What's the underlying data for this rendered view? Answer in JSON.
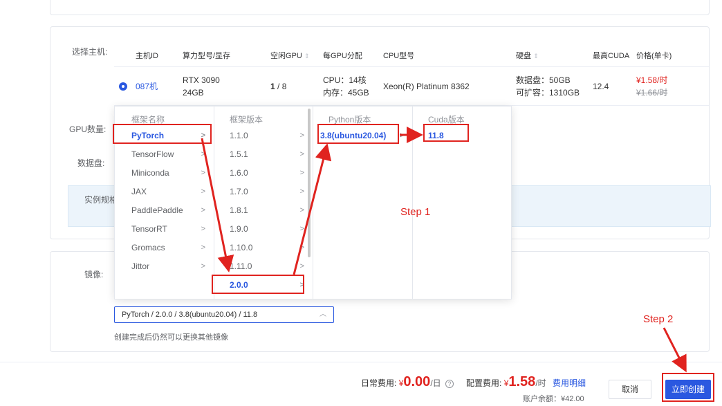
{
  "host": {
    "label": "选择主机:",
    "headers": {
      "host_id": "主机ID",
      "gpu_model": "算力型号/显存",
      "idle_gpu": "空闲GPU",
      "per_gpu": "每GPU分配",
      "cpu_model": "CPU型号",
      "disk": "硬盘",
      "max_cuda": "最高CUDA",
      "price": "价格(单卡)"
    },
    "row": {
      "id": "087机",
      "gpu_name": "RTX 3090",
      "gpu_mem": "24GB",
      "idle_num": "1",
      "idle_total": " / 8",
      "cpu_alloc": "CPU：14核",
      "mem_alloc": "内存：45GB",
      "cpu_model": "Xeon(R) Platinum 8362",
      "data_disk": "数据盘：50GB",
      "expandable": "可扩容：1310GB",
      "cuda": "12.4",
      "price": "¥1.58/时",
      "old_price": "¥1.66/时"
    }
  },
  "form": {
    "gpu_count_label": "GPU数量:",
    "data_disk_label": "数据盘:",
    "instance_spec_label": "实例规格",
    "image_label": "镜像:",
    "image_value": "PyTorch / 2.0.0 / 3.8(ubuntu20.04) / 11.8",
    "image_hint": "创建完成后仍然可以更换其他镜像"
  },
  "cascader": {
    "col1_header": "框架名称",
    "frameworks": [
      "PyTorch",
      "TensorFlow",
      "Miniconda",
      "JAX",
      "PaddlePaddle",
      "TensorRT",
      "Gromacs",
      "Jittor"
    ],
    "col2_header": "框架版本",
    "versions": [
      "1.1.0",
      "1.5.1",
      "1.6.0",
      "1.7.0",
      "1.8.1",
      "1.9.0",
      "1.10.0",
      "1.11.0",
      "2.0.0"
    ],
    "col3_header": "Python版本",
    "python": [
      "3.8(ubuntu20.04)"
    ],
    "col4_header": "Cuda版本",
    "cuda": [
      "11.8"
    ]
  },
  "annotations": {
    "step1": "Step 1",
    "step2": "Step 2",
    "color": "#e0231f"
  },
  "footer": {
    "daily_label": "日常费用:",
    "daily_currency": "¥",
    "daily_value": "0.00",
    "daily_unit": "/日",
    "help_icon": "?",
    "config_label": "配置费用:",
    "config_currency": "¥",
    "config_value": "1.58",
    "config_unit": "/时",
    "fee_detail_link": "费用明细",
    "balance": "账户余额：¥42.00",
    "cancel_button": "取消",
    "create_button": "立即创建"
  },
  "colors": {
    "primary": "#2a58e0",
    "accent_red": "#e0231f"
  }
}
